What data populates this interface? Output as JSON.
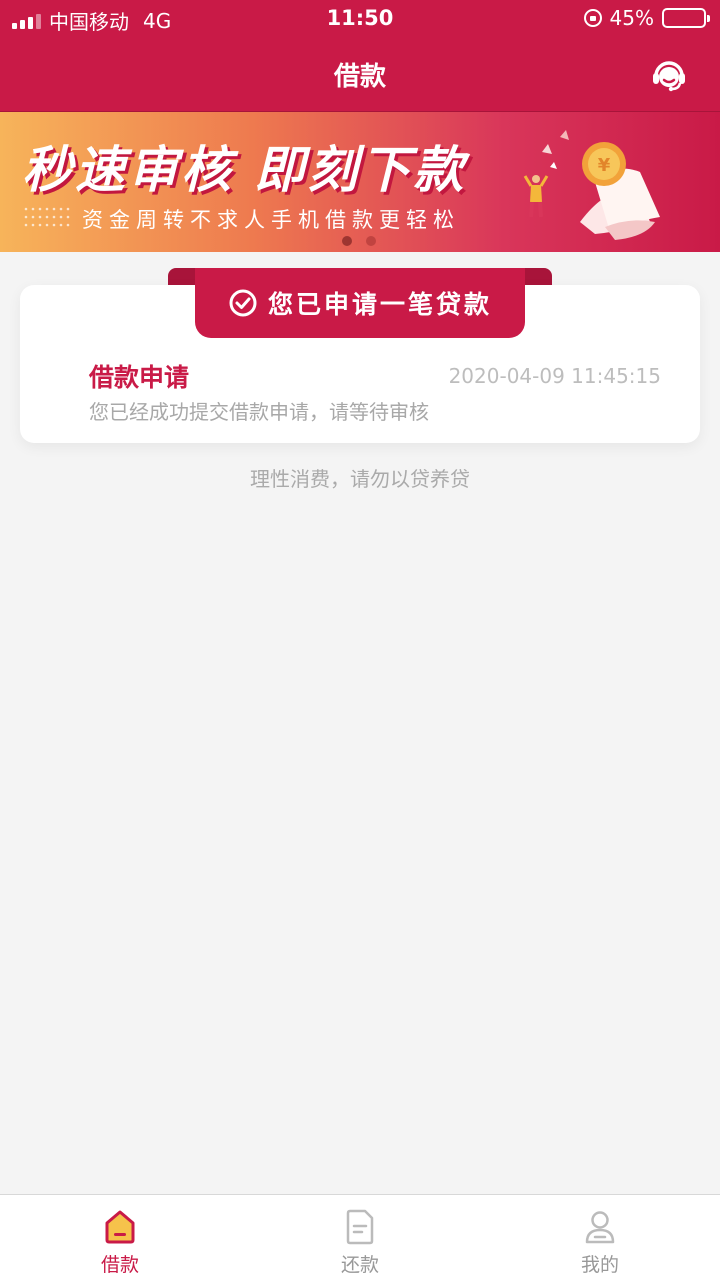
{
  "status_bar": {
    "carrier": "中国移动",
    "network": "4G",
    "time": "11:50",
    "battery_percent": "45%",
    "battery_level": 0.45
  },
  "nav": {
    "title": "借款",
    "right_icon": "customer-service-icon"
  },
  "banner": {
    "headline": "秒速审核 即刻下款",
    "subtitle": "资金周转不求人手机借款更轻松",
    "page_count": 2,
    "active_page": 0,
    "currency_symbol": "¥"
  },
  "application_card": {
    "ribbon_icon": "check-circle-icon",
    "ribbon_text": "您已申请一笔贷款",
    "title": "借款申请",
    "timestamp": "2020-04-09 11:45:15",
    "description": "您已经成功提交借款申请，请等待审核"
  },
  "tip": "理性消费，请勿以贷养贷",
  "tab_bar": {
    "items": [
      {
        "label": "借款",
        "icon": "home-icon",
        "active": true
      },
      {
        "label": "还款",
        "icon": "document-icon",
        "active": false
      },
      {
        "label": "我的",
        "icon": "user-icon",
        "active": false
      }
    ]
  },
  "colors": {
    "brand": "#c91a47",
    "background": "#f4f4f4"
  }
}
